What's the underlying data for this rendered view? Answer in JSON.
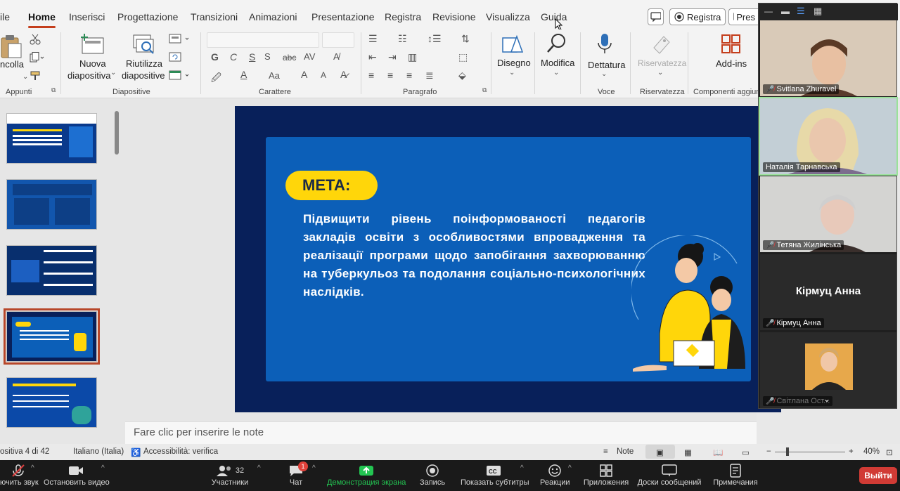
{
  "ribbon_tabs": [
    "ile",
    "Home",
    "Inserisci",
    "Progettazione",
    "Transizioni",
    "Animazioni",
    "Presentazione",
    "Registra",
    "Revisione",
    "Visualizza",
    "Guida"
  ],
  "top_buttons": {
    "registra": "Registra",
    "present": "Pres"
  },
  "ribbon": {
    "incolla": "ncolla",
    "appunti": "Appunti",
    "nuova_1": "Nuova",
    "nuova_2": "diapositiva",
    "riutilizza_1": "Riutilizza",
    "riutilizza_2": "diapositive",
    "diapositive": "Diapositive",
    "carattere": "Carattere",
    "paragrafo": "Paragrafo",
    "disegno": "Disegno",
    "modifica": "Modifica",
    "dettatura": "Dettatura",
    "voce": "Voce",
    "riservatezza_btn": "Riservatezza",
    "riservatezza": "Riservatezza",
    "addins": "Add-ins",
    "componenti": "Componenti aggiun",
    "font_row": [
      "G",
      "C",
      "S",
      "abc",
      "AV"
    ],
    "font_row2": [
      "Aa",
      "A",
      "A"
    ]
  },
  "slide": {
    "pill": "МЕТА:",
    "body": "Підвищити рівень поінформованості педагогів закладів освіти з особливостями впровадження та реалізації програми щодо запобігання захворюванню на туберкульоз та подолання соціально-психологічних наслідків."
  },
  "notes_placeholder": "Fare clic per inserire le note",
  "status": {
    "slide_count": "ositiva 4 di 42",
    "language": "Italiano (Italia)",
    "accessibility": "Accessibilità: verifica",
    "notes": "Note",
    "zoom": "40%"
  },
  "participants": [
    {
      "name": "Svitlana Zhuravel",
      "muted": true
    },
    {
      "name": "Наталія Тарнавська",
      "muted": false,
      "active": true
    },
    {
      "name": "Тетяна Жилінська",
      "muted": true
    },
    {
      "name": "Кірмуц Анна",
      "muted": true,
      "big_name": "Кірмуц Анна"
    },
    {
      "name": "Світлана Ост...",
      "muted": true
    }
  ],
  "zoom_toolbar": {
    "mute": "ючить звук",
    "video": "Остановить видео",
    "participants": "Участники",
    "participants_count": "32",
    "chat": "Чат",
    "chat_badge": "1",
    "share": "Демонстрация экрана",
    "record": "Запись",
    "subtitles": "Показать субтитры",
    "reactions": "Реакции",
    "apps": "Приложения",
    "whiteboards": "Доски сообщений",
    "notes": "Примечания",
    "exit": "Выйти"
  },
  "colors": {
    "accent": "#c43e1c",
    "slide_bg": "#08205a",
    "slide_inner": "#0c5fb8",
    "pill": "#ffd60a",
    "share_green": "#23c552",
    "exit_red": "#d13b35"
  }
}
